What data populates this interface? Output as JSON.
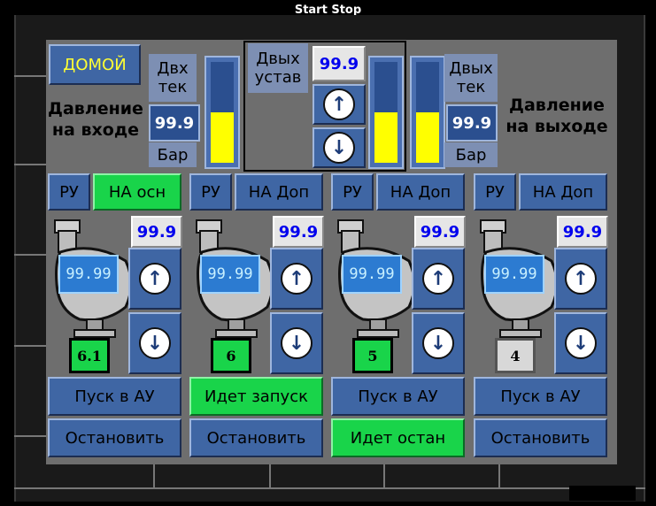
{
  "window": {
    "title": "Start Stop"
  },
  "home_button": "ДОМОЙ",
  "inlet": {
    "heading": "Давление на входе",
    "label_top": "Двх тек",
    "value": "99.9",
    "unit": "Бар",
    "level_fraction": 0.5
  },
  "setpoint": {
    "label": "Двых устав",
    "value": "99.9",
    "up_icon": "arrow-up-icon",
    "down_icon": "arrow-down-icon",
    "level_fraction": 0.5
  },
  "outlet": {
    "heading": "Давление на выходе",
    "label_top": "Двых тек",
    "value": "99.9",
    "unit": "Бар",
    "level_fraction": 0.5
  },
  "pumps": [
    {
      "mode": "РУ",
      "source": "НА осн",
      "source_active": true,
      "setpoint": "99.9",
      "display": "99.99",
      "counter": "6.1",
      "counter_active": true,
      "start": "Пуск в АУ",
      "start_active": false,
      "stop": "Остановить",
      "stop_active": false
    },
    {
      "mode": "РУ",
      "source": "НА Доп",
      "source_active": false,
      "setpoint": "99.9",
      "display": "99.99",
      "counter": "6",
      "counter_active": true,
      "start": "Идет запуск",
      "start_active": true,
      "stop": "Остановить",
      "stop_active": false
    },
    {
      "mode": "РУ",
      "source": "НА Доп",
      "source_active": false,
      "setpoint": "99.9",
      "display": "99.99",
      "counter": "5",
      "counter_active": true,
      "start": "Пуск в АУ",
      "start_active": false,
      "stop": "Идет остан",
      "stop_active": true
    },
    {
      "mode": "РУ",
      "source": "НА Доп",
      "source_active": false,
      "setpoint": "99.9",
      "display": "99.99",
      "counter": "4",
      "counter_active": false,
      "start": "Пуск в АУ",
      "start_active": false,
      "stop": "Остановить",
      "stop_active": false
    }
  ],
  "colors": {
    "panel": "#6e6e6e",
    "button": "#3f66a4",
    "active": "#19d44a",
    "level": "#ffff00",
    "setpoint_text": "#0000ee"
  }
}
